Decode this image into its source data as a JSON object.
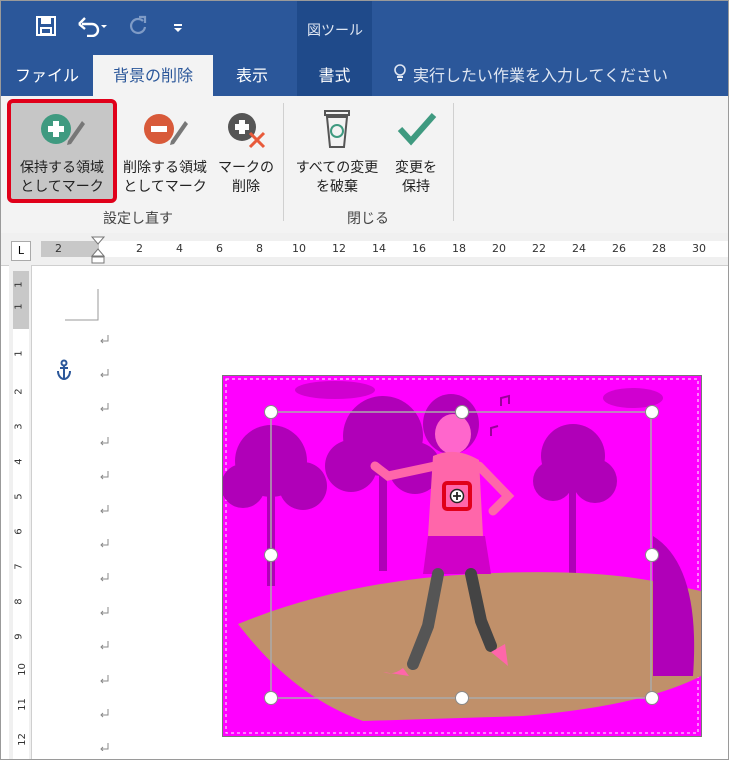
{
  "qat": {
    "save_icon": "save-icon",
    "undo_icon": "undo-icon",
    "redo_icon": "redo-icon",
    "customize_icon": "customize-icon"
  },
  "context": {
    "group_label": "図ツール"
  },
  "tabs": [
    {
      "label": "ファイル"
    },
    {
      "label": "背景の削除"
    },
    {
      "label": "表示"
    },
    {
      "label": "書式"
    }
  ],
  "tell_me": {
    "text": "実行したい作業を入力してください"
  },
  "ribbon": {
    "keep": {
      "line1": "保持する領域",
      "line2": "としてマーク"
    },
    "remove": {
      "line1": "削除する領域",
      "line2": "としてマーク"
    },
    "delete_mark": {
      "line1": "マークの",
      "line2": "削除"
    },
    "discard": {
      "line1": "すべての変更",
      "line2": "を破棄"
    },
    "keep_changes": {
      "line1": "変更を",
      "line2": "保持"
    },
    "group_refine": "設定し直す",
    "group_close": "閉じる"
  },
  "ruler": {
    "corner": "L",
    "h_ticks": [
      "2",
      "2",
      "4",
      "6",
      "8",
      "10",
      "12",
      "14",
      "16",
      "18",
      "20",
      "22",
      "24",
      "26",
      "28",
      "30"
    ],
    "v_ticks": [
      "1",
      "1",
      "1",
      "2",
      "3",
      "4",
      "5",
      "6",
      "7",
      "8",
      "9",
      "10",
      "11",
      "12"
    ]
  },
  "colors": {
    "accent": "#2b579a",
    "highlight": "#e0001a",
    "removed": "#ff00ff"
  }
}
